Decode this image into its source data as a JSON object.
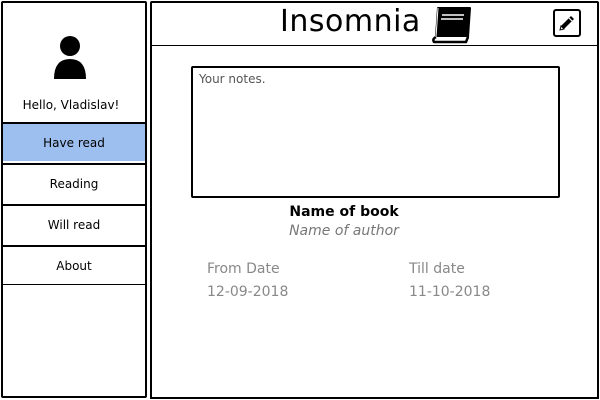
{
  "header": {
    "title": "Insomnia",
    "logo_icon": "book-icon",
    "edit_icon": "pencil-icon"
  },
  "sidebar": {
    "avatar_icon": "user-icon",
    "greeting": "Hello, Vladislav!",
    "items": [
      {
        "label": "Have read",
        "active": true
      },
      {
        "label": "Reading",
        "active": false
      },
      {
        "label": "Will read",
        "active": false
      },
      {
        "label": "About",
        "active": false
      }
    ]
  },
  "main": {
    "notes_placeholder": "Your notes.",
    "book_name": "Name of book",
    "author_name": "Name of author",
    "from_label": "From Date",
    "from_value": "12-09-2018",
    "till_label": "Till date",
    "till_value": "11-10-2018"
  },
  "colors": {
    "active_nav": "#9dbff0",
    "muted_text": "#888888"
  }
}
